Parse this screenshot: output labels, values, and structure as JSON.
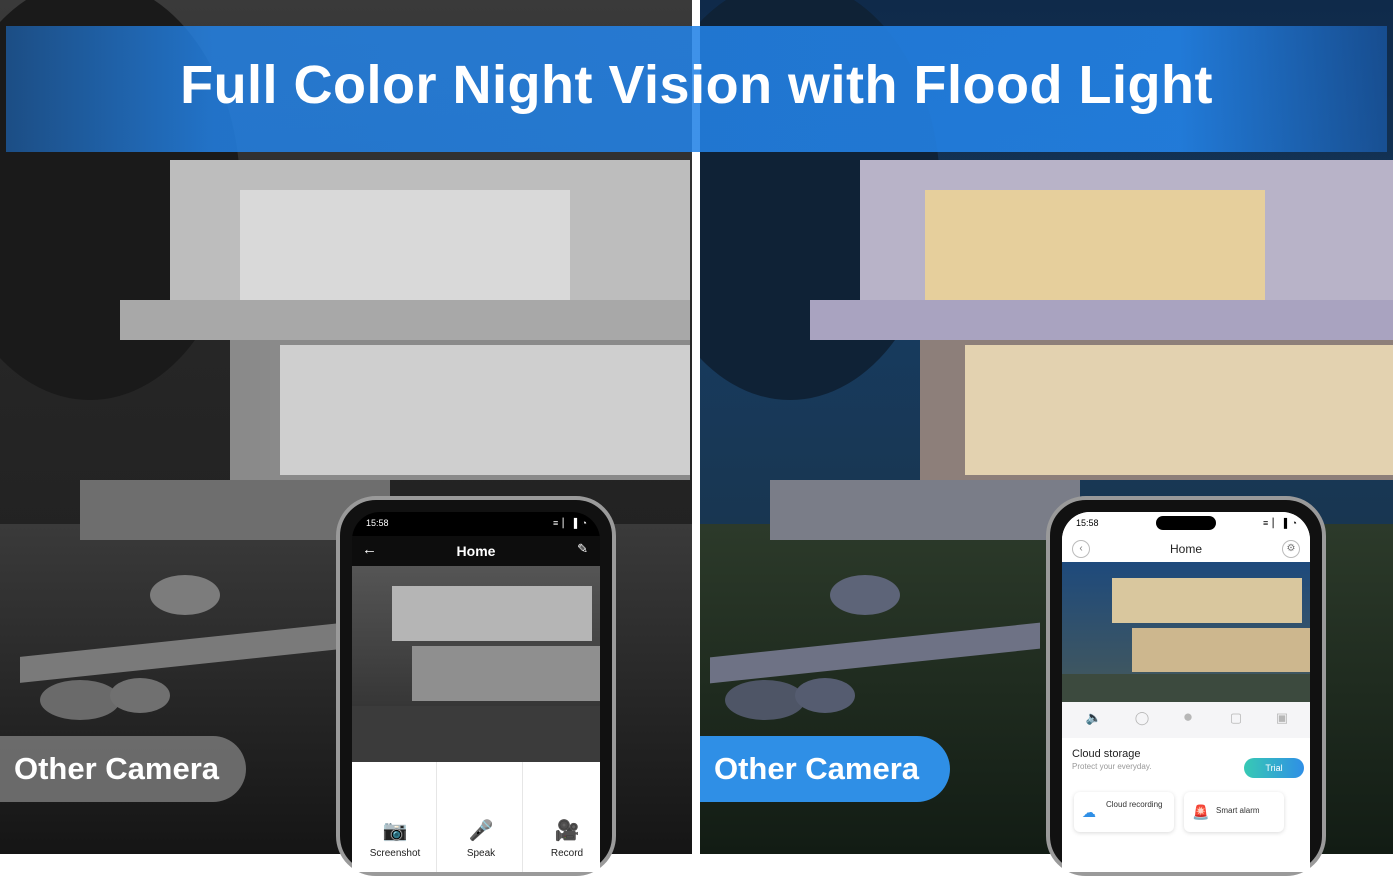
{
  "banner": {
    "title": "Full Color Night Vision with Flood Light"
  },
  "labels": {
    "left": "Other Camera",
    "right": "Other Camera"
  },
  "phone_left": {
    "time": "15:58",
    "status_icons": "≡ ▏▐ ◔",
    "title": "Home",
    "back_icon": "arrow-left-icon",
    "edit_icon": "pencil-icon",
    "controls": [
      {
        "label": "Screenshot",
        "icon": "camera-icon"
      },
      {
        "label": "Speak",
        "icon": "microphone-icon"
      },
      {
        "label": "Record",
        "icon": "video-icon"
      }
    ]
  },
  "phone_right": {
    "time": "15:58",
    "status_icons": "≡ ▏▐ ◔",
    "title": "Home",
    "cloud_title": "Cloud storage",
    "cloud_subtitle": "Protect your everyday.",
    "trial": "Trial",
    "cards": [
      {
        "label": "Cloud recording",
        "icon": "cloud-icon"
      },
      {
        "label": "Smart alarm",
        "icon": "alarm-icon"
      }
    ]
  },
  "colors": {
    "banner_blue": "#2382e6",
    "label_blue": "#2f8fe6",
    "label_gray": "#787878"
  }
}
